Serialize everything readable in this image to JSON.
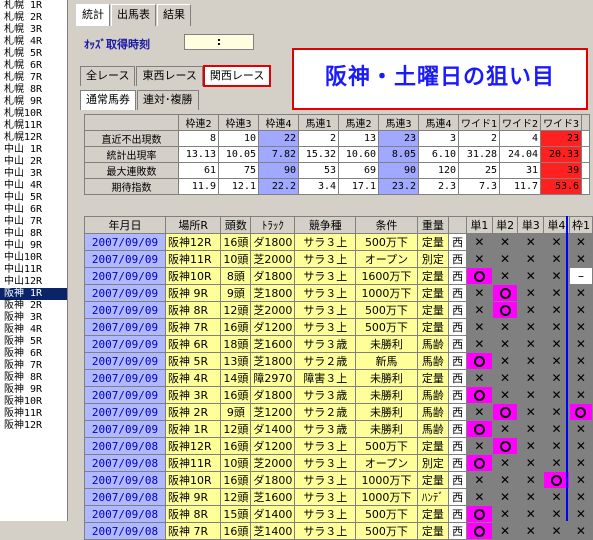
{
  "race_list": {
    "items": [
      "札幌 1R",
      "札幌 2R",
      "札幌 3R",
      "札幌 4R",
      "札幌 5R",
      "札幌 6R",
      "札幌 7R",
      "札幌 8R",
      "札幌 9R",
      "札幌10R",
      "札幌11R",
      "札幌12R",
      "中山 1R",
      "中山 2R",
      "中山 3R",
      "中山 4R",
      "中山 5R",
      "中山 6R",
      "中山 7R",
      "中山 8R",
      "中山 9R",
      "中山10R",
      "中山11R",
      "中山12R",
      "阪神 1R",
      "阪神 2R",
      "阪神 3R",
      "阪神 4R",
      "阪神 5R",
      "阪神 6R",
      "阪神 7R",
      "阪神 8R",
      "阪神 9R",
      "阪神10R",
      "阪神11R",
      "阪神12R"
    ],
    "selected": "阪神 1R"
  },
  "top_tabs": [
    "統計",
    "出馬表",
    "結果"
  ],
  "odds": {
    "label": "ｵｯｽﾞ取得時刻",
    "value": ":"
  },
  "region_tabs": [
    "全レース",
    "東西レース",
    "関西レース"
  ],
  "type_tabs": [
    "通常馬券",
    "連対･複勝"
  ],
  "banner": "阪神・土曜日の狙い目",
  "stats": {
    "columns": [
      "枠連2",
      "枠連3",
      "枠連4",
      "馬連1",
      "馬連2",
      "馬連3",
      "馬連4",
      "ワイド1",
      "ワイド2",
      "ワイド3"
    ],
    "rows": [
      {
        "label": "直近不出現数",
        "values": [
          "8",
          "10",
          "22",
          "2",
          "13",
          "23",
          "3",
          "2",
          "4",
          "23"
        ]
      },
      {
        "label": "統計出現率",
        "values": [
          "13.13",
          "10.05",
          "7.82",
          "15.32",
          "10.60",
          "8.05",
          "6.10",
          "31.28",
          "24.04",
          "20.33"
        ]
      },
      {
        "label": "最大連敗数",
        "values": [
          "61",
          "75",
          "90",
          "53",
          "69",
          "90",
          "120",
          "25",
          "31",
          "39"
        ]
      },
      {
        "label": "期待指数",
        "values": [
          "11.9",
          "12.1",
          "22.2",
          "3.4",
          "17.1",
          "23.2",
          "2.3",
          "7.3",
          "11.7",
          "53.6"
        ]
      }
    ]
  },
  "grid": {
    "headers": [
      "年月日",
      "場所R",
      "頭数",
      "ﾄﾗｯｸ",
      "競争種",
      "条件",
      "重量",
      "",
      "単1",
      "単2",
      "単3",
      "単4",
      "枠1"
    ],
    "rows": [
      {
        "date": "2007/09/09",
        "place": "阪神12R",
        "count": "16頭",
        "track": "ダ1800",
        "kind": "サラ３上",
        "cond": "500万下",
        "wt": "定量",
        "dir": "西",
        "marks": [
          "x",
          "x",
          "x",
          "x",
          "x"
        ]
      },
      {
        "date": "2007/09/09",
        "place": "阪神11R",
        "count": "10頭",
        "track": "芝2000",
        "kind": "サラ３上",
        "cond": "オープン",
        "wt": "別定",
        "dir": "西",
        "marks": [
          "x",
          "x",
          "x",
          "x",
          "x"
        ]
      },
      {
        "date": "2007/09/09",
        "place": "阪神10R",
        "count": "8頭",
        "track": "ダ1800",
        "kind": "サラ３上",
        "cond": "1600万下",
        "wt": "定量",
        "dir": "西",
        "marks": [
          "o",
          "x",
          "x",
          "x",
          "-"
        ]
      },
      {
        "date": "2007/09/09",
        "place": "阪神 9R",
        "count": "9頭",
        "track": "芝1800",
        "kind": "サラ３上",
        "cond": "1000万下",
        "wt": "定量",
        "dir": "西",
        "marks": [
          "x",
          "o",
          "x",
          "x",
          "x"
        ]
      },
      {
        "date": "2007/09/09",
        "place": "阪神 8R",
        "count": "12頭",
        "track": "芝2000",
        "kind": "サラ３上",
        "cond": "500万下",
        "wt": "定量",
        "dir": "西",
        "marks": [
          "x",
          "o",
          "x",
          "x",
          "x"
        ]
      },
      {
        "date": "2007/09/09",
        "place": "阪神 7R",
        "count": "16頭",
        "track": "ダ1200",
        "kind": "サラ３上",
        "cond": "500万下",
        "wt": "定量",
        "dir": "西",
        "marks": [
          "x",
          "x",
          "x",
          "x",
          "x"
        ]
      },
      {
        "date": "2007/09/09",
        "place": "阪神 6R",
        "count": "18頭",
        "track": "芝1600",
        "kind": "サラ３歳",
        "cond": "未勝利",
        "wt": "馬齢",
        "dir": "西",
        "marks": [
          "x",
          "x",
          "x",
          "x",
          "x"
        ]
      },
      {
        "date": "2007/09/09",
        "place": "阪神 5R",
        "count": "13頭",
        "track": "芝1800",
        "kind": "サラ２歳",
        "cond": "新馬",
        "wt": "馬齢",
        "dir": "西",
        "marks": [
          "o",
          "x",
          "x",
          "x",
          "x"
        ]
      },
      {
        "date": "2007/09/09",
        "place": "阪神 4R",
        "count": "14頭",
        "track": "障2970",
        "kind": "障害３上",
        "cond": "未勝利",
        "wt": "定量",
        "dir": "西",
        "marks": [
          "x",
          "x",
          "x",
          "x",
          "x"
        ]
      },
      {
        "date": "2007/09/09",
        "place": "阪神 3R",
        "count": "16頭",
        "track": "ダ1800",
        "kind": "サラ３歳",
        "cond": "未勝利",
        "wt": "馬齢",
        "dir": "西",
        "marks": [
          "o",
          "x",
          "x",
          "x",
          "x"
        ]
      },
      {
        "date": "2007/09/09",
        "place": "阪神 2R",
        "count": "9頭",
        "track": "芝1200",
        "kind": "サラ２歳",
        "cond": "未勝利",
        "wt": "馬齢",
        "dir": "西",
        "marks": [
          "x",
          "o",
          "x",
          "x",
          "o"
        ]
      },
      {
        "date": "2007/09/09",
        "place": "阪神 1R",
        "count": "12頭",
        "track": "ダ1400",
        "kind": "サラ３歳",
        "cond": "未勝利",
        "wt": "馬齢",
        "dir": "西",
        "marks": [
          "o",
          "x",
          "x",
          "x",
          "x"
        ]
      },
      {
        "date": "2007/09/08",
        "place": "阪神12R",
        "count": "16頭",
        "track": "ダ1200",
        "kind": "サラ３上",
        "cond": "500万下",
        "wt": "定量",
        "dir": "西",
        "marks": [
          "x",
          "o",
          "x",
          "x",
          "x"
        ]
      },
      {
        "date": "2007/09/08",
        "place": "阪神11R",
        "count": "10頭",
        "track": "芝2000",
        "kind": "サラ３上",
        "cond": "オープン",
        "wt": "別定",
        "dir": "西",
        "marks": [
          "o",
          "x",
          "x",
          "x",
          "x"
        ]
      },
      {
        "date": "2007/09/08",
        "place": "阪神10R",
        "count": "16頭",
        "track": "ダ1800",
        "kind": "サラ３上",
        "cond": "1000万下",
        "wt": "定量",
        "dir": "西",
        "marks": [
          "x",
          "x",
          "x",
          "o",
          "x"
        ]
      },
      {
        "date": "2007/09/08",
        "place": "阪神 9R",
        "count": "12頭",
        "track": "芝1600",
        "kind": "サラ３上",
        "cond": "1000万下",
        "wt": "ﾊﾝﾃﾞ",
        "dir": "西",
        "marks": [
          "x",
          "x",
          "x",
          "x",
          "x"
        ]
      },
      {
        "date": "2007/09/08",
        "place": "阪神 8R",
        "count": "15頭",
        "track": "ダ1400",
        "kind": "サラ３上",
        "cond": "500万下",
        "wt": "定量",
        "dir": "西",
        "marks": [
          "o",
          "x",
          "x",
          "x",
          "x"
        ]
      },
      {
        "date": "2007/09/08",
        "place": "阪神 7R",
        "count": "16頭",
        "track": "芝1400",
        "kind": "サラ３上",
        "cond": "500万下",
        "wt": "定量",
        "dir": "西",
        "marks": [
          "o",
          "x",
          "x",
          "x",
          "x"
        ]
      }
    ]
  },
  "colors": {
    "highlight": "#a0a8ff",
    "hit": "#ff00ff",
    "red": "#ff2020",
    "banner_text": "#1a1aff"
  }
}
